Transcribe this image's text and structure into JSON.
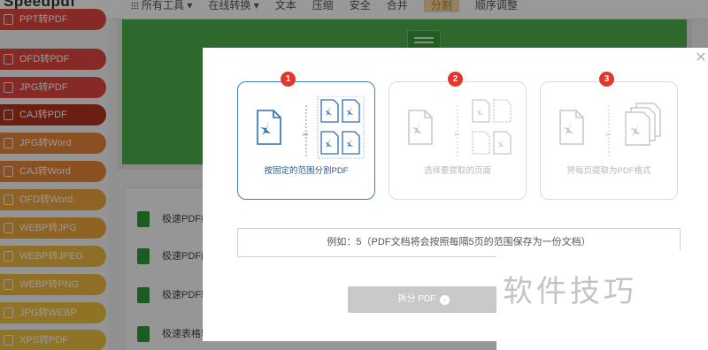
{
  "app": {
    "logo": "Speedpdf"
  },
  "topnav": {
    "items": [
      {
        "label": "所有工具",
        "has_dropdown": true,
        "active": false
      },
      {
        "label": "在线转换",
        "has_dropdown": true,
        "active": false
      },
      {
        "label": "文本",
        "has_dropdown": false,
        "active": false
      },
      {
        "label": "压缩",
        "has_dropdown": false,
        "active": false
      },
      {
        "label": "安全",
        "has_dropdown": false,
        "active": false
      },
      {
        "label": "合并",
        "has_dropdown": false,
        "active": false
      },
      {
        "label": "分割",
        "has_dropdown": false,
        "active": true
      },
      {
        "label": "顺序调整",
        "has_dropdown": false,
        "active": false
      }
    ]
  },
  "sidebar": {
    "items": [
      {
        "label": "PPT转PDF",
        "color": "#e2473f"
      },
      {
        "label": "OFD转PDF",
        "color": "#e2473f"
      },
      {
        "label": "JPG转PDF",
        "color": "#e2473f"
      },
      {
        "label": "CAJ转PDF",
        "color": "#b2341f"
      },
      {
        "label": "JPG转Word",
        "color": "#e8853a"
      },
      {
        "label": "CAJ转Word",
        "color": "#e8853a"
      },
      {
        "label": "OFD转Word",
        "color": "#eda53c"
      },
      {
        "label": "WEBP转JPG",
        "color": "#eda53c"
      },
      {
        "label": "WEBP转JPEG",
        "color": "#efb73f"
      },
      {
        "label": "WEBP转PNG",
        "color": "#efb73f"
      },
      {
        "label": "JPG转WEBP",
        "color": "#f0c23e"
      },
      {
        "label": "XPS转PDF",
        "color": "#f0c23e"
      }
    ]
  },
  "tool_list": {
    "items": [
      {
        "label": "极速PDF编"
      },
      {
        "label": "极速PDF阅"
      },
      {
        "label": "极速PDF转"
      },
      {
        "label": "极速表格转"
      }
    ]
  },
  "modal": {
    "close_icon": "close-icon",
    "options": [
      {
        "step": "1",
        "label": "按固定的范围分割PDF",
        "selected": true
      },
      {
        "step": "2",
        "label": "选择要提取的页面",
        "selected": false
      },
      {
        "step": "3",
        "label": "将每页提取为PDF格式",
        "selected": false
      }
    ],
    "hint": "例如：5（PDF文档将会按照每隔5页的范围保存为一份文档）",
    "split_button": "拆分 PDF"
  },
  "watermark": "软件技巧",
  "colors": {
    "accent_red": "#e3362d",
    "selected_border": "#4a7fb5",
    "pdf_icon_blue": "#2c6fb5",
    "disabled_button": "#c9c9c9"
  }
}
